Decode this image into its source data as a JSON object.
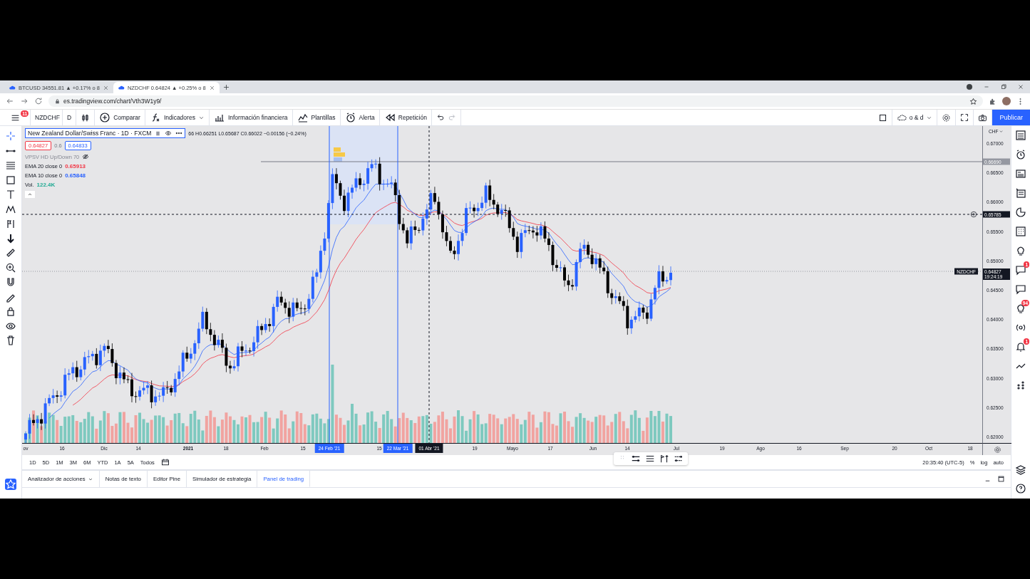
{
  "browser": {
    "tabs": [
      {
        "title": "BTCUSD 34551.81 ▲ +0.17% o 8",
        "selected": false
      },
      {
        "title": "NZDCHF 0.64824 ▲ +0.25% o 8",
        "selected": true
      }
    ],
    "url": "es.tradingview.com/chart/Vth3W1y9/"
  },
  "toolbar": {
    "menu_badge": "11",
    "symbol": "NZDCHF",
    "interval": "D",
    "items": [
      {
        "label": "Comparar",
        "kind": "compare"
      },
      {
        "label": "Indicadores",
        "kind": "indicators"
      },
      {
        "label": "Información financiera",
        "kind": "financials"
      },
      {
        "label": "Plantillas",
        "kind": "templates"
      },
      {
        "label": "Alerta",
        "kind": "alert"
      },
      {
        "label": "Repetición",
        "kind": "replay"
      }
    ],
    "layout_name": "o & d",
    "publish": "Publicar"
  },
  "legend": {
    "title": "New Zealand Dollar/Swiss Franc · 1D · FXCM",
    "ohlc": "66 H0.66251 L0.65687 C0.66022 −0.00156 (−0.24%)",
    "sell": "0.64827",
    "spread": "0.6",
    "buy": "0.64833",
    "indicators": [
      {
        "name": "VPSV HD Up/Down 70",
        "hidden": true
      },
      {
        "name": "EMA 20 close 0",
        "value": "0.65913",
        "color": "#f23645",
        "hidden": false
      },
      {
        "name": "EMA 10 close 0",
        "value": "0.65848",
        "color": "#2962ff",
        "hidden": false
      },
      {
        "name": "Vol.",
        "value": "122.4K",
        "color": "#22ab94",
        "hidden": false
      }
    ]
  },
  "price_axis": {
    "currency": "CHF",
    "ticks": [
      "0.67000",
      "0.66500",
      "0.66000",
      "0.65500",
      "0.65000",
      "0.64500",
      "0.64000",
      "0.63500",
      "0.63000",
      "0.62500",
      "0.62000"
    ],
    "labels": [
      {
        "kind": "line",
        "text": "0.66690"
      },
      {
        "kind": "crosshair",
        "text": "0.65785"
      },
      {
        "kind": "last",
        "symbol": "NZDCHF",
        "text": "0.64827",
        "countdown": "19:24:19"
      }
    ]
  },
  "time_axis": {
    "ticks": [
      "ov",
      "16",
      "Dic",
      "14",
      "2021",
      "18",
      "Feb",
      "15",
      "15",
      "19",
      "Mayo",
      "17",
      "Jun",
      "14",
      "Jul",
      "19",
      "Ago",
      "16",
      "Sep",
      "20",
      "Oct",
      "18"
    ],
    "markers": [
      {
        "text": "24 Feb '21",
        "kind": "selected"
      },
      {
        "text": "22 Mar '21",
        "kind": "selected"
      },
      {
        "text": "01 Abr '21",
        "kind": "crosshair"
      }
    ]
  },
  "range_bar": {
    "ranges": [
      "1D",
      "5D",
      "1M",
      "3M",
      "6M",
      "YTD",
      "1A",
      "5A",
      "Todos"
    ],
    "time": "20:35:40 (UTC-5)",
    "options": [
      "%",
      "log",
      "auto"
    ]
  },
  "bottom_tabs": [
    {
      "label": "Analizador de acciones",
      "selected": false
    },
    {
      "label": "Notas de texto",
      "selected": false
    },
    {
      "label": "Editor Pine",
      "selected": false
    },
    {
      "label": "Simulador de estrategia",
      "selected": false
    },
    {
      "label": "Panel de trading",
      "selected": true
    }
  ],
  "sidebar_badges": {
    "chat": "1",
    "ideas": "94",
    "alerts": "1"
  }
}
